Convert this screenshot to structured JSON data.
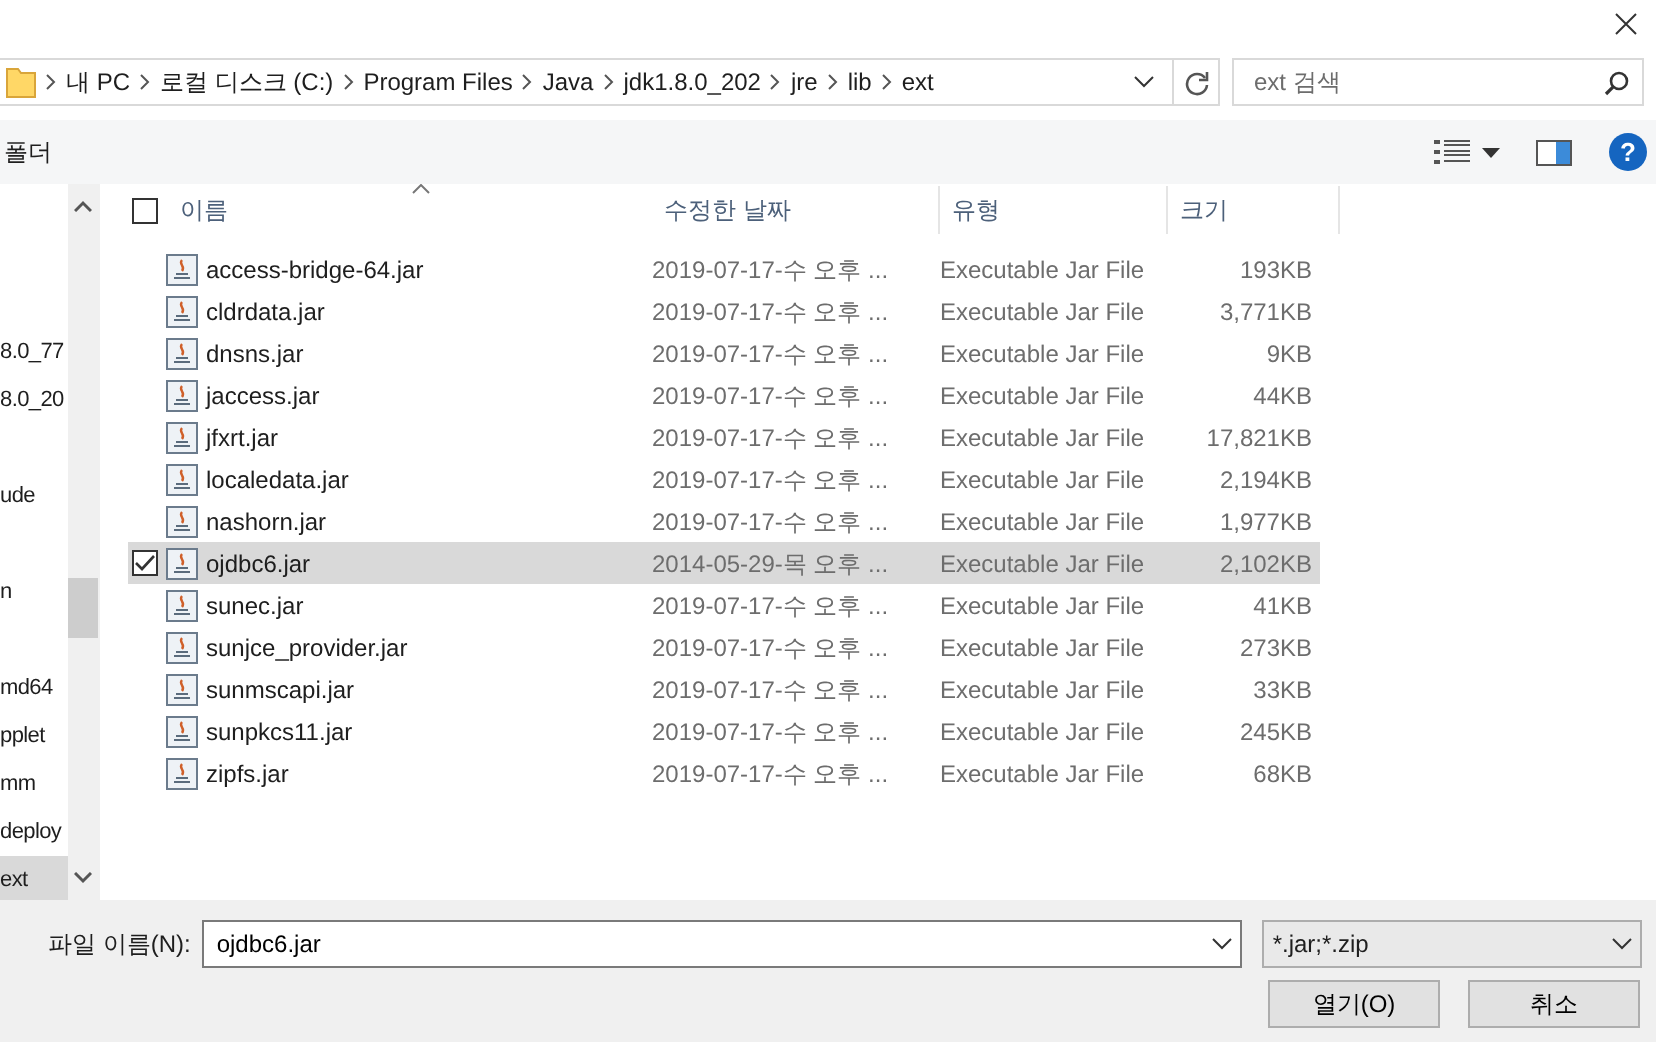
{
  "address_bar": {
    "crumbs": [
      "내 PC",
      "로컬 디스크 (C:)",
      "Program Files",
      "Java",
      "jdk1.8.0_202",
      "jre",
      "lib",
      "ext"
    ]
  },
  "search": {
    "placeholder": "ext 검색"
  },
  "toolbar": {
    "new_folder": "폴더",
    "help": "?"
  },
  "nav_pane": {
    "items": [
      {
        "label": "8.0_77",
        "selected": false
      },
      {
        "label": "8.0_20",
        "selected": false
      },
      {
        "label": "ude",
        "selected": false
      },
      {
        "label": "n",
        "selected": false
      },
      {
        "label": "md64",
        "selected": false
      },
      {
        "label": "pplet",
        "selected": false
      },
      {
        "label": "mm",
        "selected": false
      },
      {
        "label": "deploy",
        "selected": false
      },
      {
        "label": "ext",
        "selected": true
      }
    ]
  },
  "table": {
    "select_all": {
      "checked": false
    },
    "columns": [
      "이름",
      "수정한 날짜",
      "유형",
      "크기"
    ],
    "rows": [
      {
        "name": "access-bridge-64.jar",
        "date": "2019-07-17-수 오후 ...",
        "type": "Executable Jar File",
        "size": "193KB",
        "selected": false
      },
      {
        "name": "cldrdata.jar",
        "date": "2019-07-17-수 오후 ...",
        "type": "Executable Jar File",
        "size": "3,771KB",
        "selected": false
      },
      {
        "name": "dnsns.jar",
        "date": "2019-07-17-수 오후 ...",
        "type": "Executable Jar File",
        "size": "9KB",
        "selected": false
      },
      {
        "name": "jaccess.jar",
        "date": "2019-07-17-수 오후 ...",
        "type": "Executable Jar File",
        "size": "44KB",
        "selected": false
      },
      {
        "name": "jfxrt.jar",
        "date": "2019-07-17-수 오후 ...",
        "type": "Executable Jar File",
        "size": "17,821KB",
        "selected": false
      },
      {
        "name": "localedata.jar",
        "date": "2019-07-17-수 오후 ...",
        "type": "Executable Jar File",
        "size": "2,194KB",
        "selected": false
      },
      {
        "name": "nashorn.jar",
        "date": "2019-07-17-수 오후 ...",
        "type": "Executable Jar File",
        "size": "1,977KB",
        "selected": false
      },
      {
        "name": "ojdbc6.jar",
        "date": "2014-05-29-목 오후 ...",
        "type": "Executable Jar File",
        "size": "2,102KB",
        "selected": true
      },
      {
        "name": "sunec.jar",
        "date": "2019-07-17-수 오후 ...",
        "type": "Executable Jar File",
        "size": "41KB",
        "selected": false
      },
      {
        "name": "sunjce_provider.jar",
        "date": "2019-07-17-수 오후 ...",
        "type": "Executable Jar File",
        "size": "273KB",
        "selected": false
      },
      {
        "name": "sunmscapi.jar",
        "date": "2019-07-17-수 오후 ...",
        "type": "Executable Jar File",
        "size": "33KB",
        "selected": false
      },
      {
        "name": "sunpkcs11.jar",
        "date": "2019-07-17-수 오후 ...",
        "type": "Executable Jar File",
        "size": "245KB",
        "selected": false
      },
      {
        "name": "zipfs.jar",
        "date": "2019-07-17-수 오후 ...",
        "type": "Executable Jar File",
        "size": "68KB",
        "selected": false
      }
    ]
  },
  "footer": {
    "filename_label": "파일 이름(N):",
    "filename": "ojdbc6.jar",
    "filter": "*.jar;*.zip",
    "buttons": [
      "열기(O)",
      "취소"
    ]
  }
}
